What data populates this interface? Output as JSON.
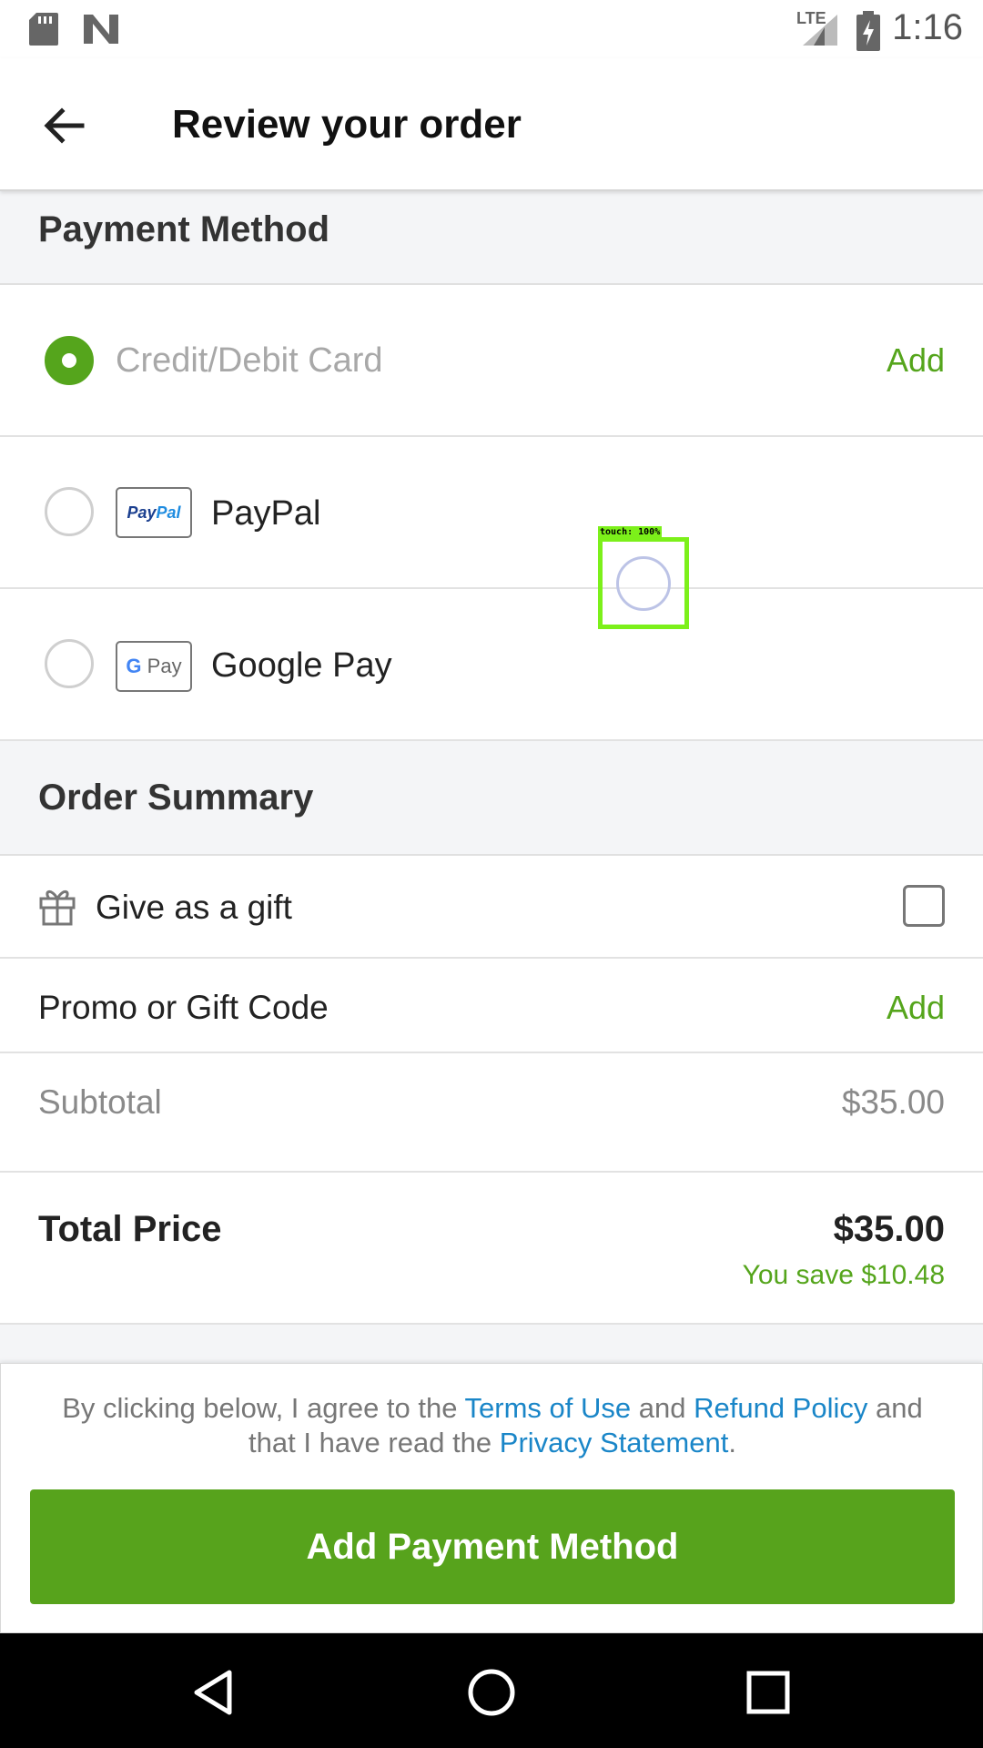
{
  "status_bar": {
    "time": "1:16",
    "network": "LTE",
    "icons": [
      "sd-card-icon",
      "n-logo-icon",
      "lte-signal-icon",
      "battery-charging-icon"
    ]
  },
  "app_bar": {
    "title": "Review your order",
    "back_icon": "back-arrow-icon"
  },
  "payment_method": {
    "header": "Payment Method",
    "options": [
      {
        "label": "Credit/Debit Card",
        "selected": true,
        "action": "Add"
      },
      {
        "label": "PayPal",
        "selected": false,
        "logo": "PayPal"
      },
      {
        "label": "Google Pay",
        "selected": false,
        "logo": "G Pay"
      }
    ]
  },
  "order_summary": {
    "header": "Order Summary",
    "gift_label": "Give as a gift",
    "gift_checked": false,
    "promo_label": "Promo or Gift Code",
    "promo_action": "Add",
    "subtotal_label": "Subtotal",
    "subtotal_value": "$35.00",
    "total_label": "Total Price",
    "total_value": "$35.00",
    "savings": "You save $10.48"
  },
  "footer": {
    "legal_prefix": "By clicking below, I agree to the ",
    "terms_link": "Terms of Use",
    "and_1": " and ",
    "refund_link": "Refund Policy",
    "and_2": " and that I have read the ",
    "privacy_link": "Privacy Statement",
    "period": ".",
    "cta_label": "Add Payment Method"
  },
  "touch_overlay": {
    "label": "touch: 100%"
  },
  "colors": {
    "accent_green": "#57a31c",
    "link_blue": "#1a86c8",
    "section_bg": "#f4f5f7"
  }
}
